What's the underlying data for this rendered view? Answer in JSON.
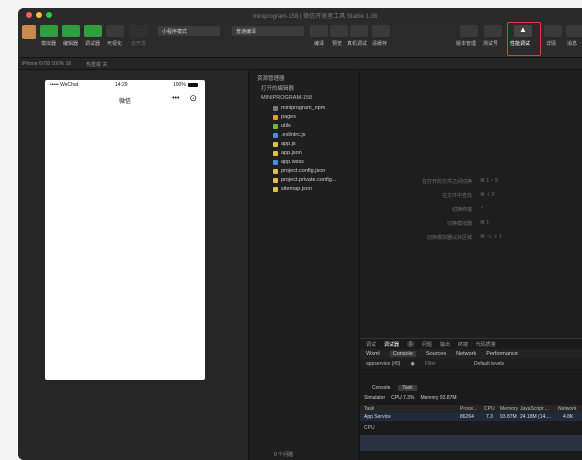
{
  "colors": {
    "close": "#ff5f57",
    "minimize": "#febc2e",
    "maximize": "#28c840",
    "toolbar_green": "#2f9e3f",
    "highlight": "#e03a3a"
  },
  "window": {
    "title": "miniprogram-158 | 微信开发者工具 Stable 1.06"
  },
  "toolbar": {
    "left_buttons": [
      {
        "label": "模拟器",
        "icon": "phone-icon"
      },
      {
        "label": "编辑器",
        "icon": "code-icon"
      },
      {
        "label": "调试器",
        "icon": "bug-icon"
      },
      {
        "label": "可视化",
        "icon": "eye-icon"
      },
      {
        "label": "云开发",
        "icon": "cloud-icon"
      }
    ],
    "mode_select": "小程序模式",
    "compile_select": "普通编译",
    "mid_buttons": [
      "编译",
      "预览",
      "真机调试",
      "清缓存"
    ],
    "right_buttons": [
      "版本管理",
      "测试号",
      "详情",
      "消息"
    ],
    "highlighted_button": "性能调试",
    "highlighted_icon": "graduation-cap-icon"
  },
  "subbar": {
    "device": "iPhone 6/7/8 100% 16",
    "network": "热重载 关"
  },
  "phone": {
    "carrier": "••••• WeChat",
    "time": "14:29",
    "battery": "100%",
    "nav_title": "微信"
  },
  "explorer": {
    "header": "资源管理器",
    "open_editors": "打开的编辑器",
    "project": "MINIPROGRAM-158",
    "items": [
      {
        "name": "miniprogram_npm",
        "type": "folder",
        "color": "#7a7a7a"
      },
      {
        "name": "pages",
        "type": "folder",
        "color": "#e0a030"
      },
      {
        "name": "utils",
        "type": "folder",
        "color": "#6bb84f"
      },
      {
        "name": ".eslintrc.js",
        "type": "file",
        "color": "#4a8fd6"
      },
      {
        "name": "app.js",
        "type": "file",
        "color": "#e0c040"
      },
      {
        "name": "app.json",
        "type": "file",
        "color": "#e0c040"
      },
      {
        "name": "app.wxss",
        "type": "file",
        "color": "#4a8fd6"
      },
      {
        "name": "project.config.json",
        "type": "file",
        "color": "#e0c040"
      },
      {
        "name": "project.private.config...",
        "type": "file",
        "color": "#e0c040"
      },
      {
        "name": "sitemap.json",
        "type": "file",
        "color": "#e0c040"
      }
    ]
  },
  "shortcuts": [
    {
      "label": "在打开的文件之间切换",
      "keys": "⌘  1 ~ 9"
    },
    {
      "label": "在文件中查找",
      "keys": "⌘  ⇧  F"
    },
    {
      "label": "切换终端",
      "keys": "⌃  `"
    },
    {
      "label": "切换模拟器",
      "keys": "⌘  1"
    },
    {
      "label": "切换模拟器以外区域",
      "keys": "⌘  ⌥  ⇧  1"
    }
  ],
  "debug": {
    "top_tabs": [
      "调试",
      "调试器",
      "1",
      "问题",
      "输出",
      "终端",
      "代码质量"
    ],
    "dev_tabs": [
      "Wxml",
      "Console",
      "Sources",
      "Network",
      "Performance"
    ],
    "active_dev_tab": "Console",
    "context": "appservice (#0)",
    "filter": "Filter",
    "levels": "Default levels",
    "task_tabs": [
      "Console",
      "Task"
    ],
    "active_task_tab": "Task",
    "simulator_label": "Simulator",
    "cpu_summary": "CPU 7.3%",
    "memory_summary": "Memory 93.87M",
    "table_headers": [
      "Task",
      "Proce...",
      "CPU",
      "Memory",
      "JavaScript ...",
      "Network"
    ],
    "table_row": [
      "App Service",
      "86264",
      "7.3",
      "93.87M",
      "24.18M (14....",
      "4.8K"
    ],
    "cpu_label": "CPU"
  },
  "status": {
    "text": "0 个问题"
  }
}
